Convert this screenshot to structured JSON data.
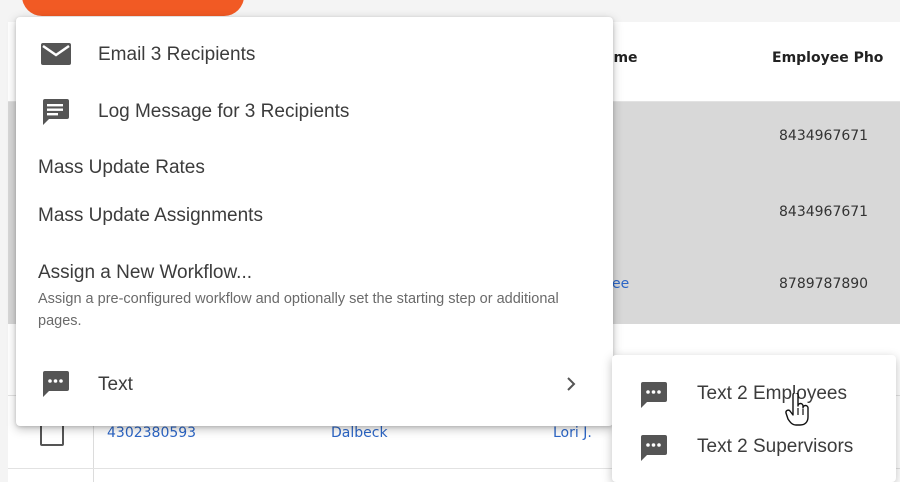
{
  "table": {
    "headers": {
      "name": "ame",
      "phone": "Employee Pho"
    },
    "rows": [
      {
        "phone": "8434967671"
      },
      {
        "phone": "8434967671"
      },
      {
        "name_fragment": "ee",
        "phone": "8789787890"
      }
    ],
    "last_row": {
      "phone": "4302380593",
      "last_name": "Dalbeck",
      "first_name": "Lori J."
    }
  },
  "menu": {
    "items": [
      {
        "label": "Email 3 Recipients",
        "icon": "envelope-icon"
      },
      {
        "label": "Log Message for 3 Recipients",
        "icon": "message-icon"
      },
      {
        "label": "Mass Update Rates"
      },
      {
        "label": "Mass Update Assignments"
      },
      {
        "label": "Assign a New Workflow...",
        "description": "Assign a pre-configured workflow and optionally set the starting step or additional pages."
      },
      {
        "label": "Text",
        "icon": "sms-icon",
        "has_submenu": true
      }
    ]
  },
  "submenu": {
    "items": [
      {
        "label": "Text 2 Employees",
        "icon": "sms-icon"
      },
      {
        "label": "Text 2 Supervisors",
        "icon": "sms-icon"
      }
    ]
  },
  "colors": {
    "accent": "#f15a24",
    "icon": "#555555",
    "link": "#2c66c7",
    "selected_row": "#d8d8d8"
  }
}
